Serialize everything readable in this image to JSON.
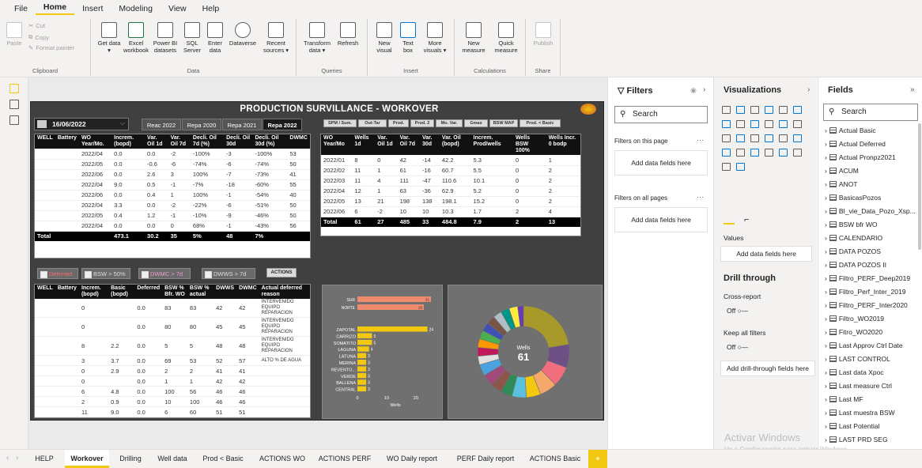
{
  "menu": {
    "items": [
      "File",
      "Home",
      "Insert",
      "Modeling",
      "View",
      "Help"
    ]
  },
  "ribbon": {
    "clipboard": {
      "paste": "Paste",
      "cut": "Cut",
      "copy": "Copy",
      "format_painter": "Format painter",
      "label": "Clipboard"
    },
    "data": {
      "get_data": "Get data ▾",
      "excel": "Excel workbook",
      "power_bi": "Power BI datasets",
      "sql": "SQL Server",
      "enter_data": "Enter data",
      "dataverse": "Dataverse",
      "recent": "Recent sources ▾",
      "label": "Data"
    },
    "queries": {
      "transform": "Transform data ▾",
      "refresh": "Refresh",
      "label": "Queries"
    },
    "insert": {
      "new_visual": "New visual",
      "text_box": "Text box",
      "more_visuals": "More visuals ▾",
      "label": "Insert"
    },
    "calculations": {
      "new_measure": "New measure",
      "quick_measure": "Quick measure",
      "label": "Calculations"
    },
    "share": {
      "publish": "Publish",
      "label": "Share"
    }
  },
  "report": {
    "title": "PRODUCTION SURVILLANCE - WORKOVER",
    "date": "16/06/2022",
    "year_buttons": [
      "Reac 2022",
      "Repa 2020",
      "Repa 2021",
      "Repa 2022"
    ],
    "small_buttons": [
      "SPM / Sum.",
      "Out-Tar",
      "Prod.",
      "Prod. 2",
      "Mo. Var.",
      "Gmax",
      "BSW MAP",
      "Prod. < Basic"
    ],
    "table1": {
      "headers": [
        "WELL",
        "Battery",
        "WO Year/Mo.",
        "Increm. (bopd)",
        "Var. Oil 1d",
        "Var. Oil 7d",
        "Decli. Oil 7d (%)",
        "Decli. Oil 30d",
        "Decli. Oil 30d (%)",
        "DWMC"
      ],
      "rows": [
        [
          "2022/04",
          "0.0",
          "0.0",
          "-2",
          "-100%",
          "-3",
          "-100%",
          "53"
        ],
        [
          "2022/05",
          "0.0",
          "-0.6",
          "-6",
          "-74%",
          "-6",
          "-74%",
          "50"
        ],
        [
          "2022/06",
          "0.0",
          "2.6",
          "3",
          "100%",
          "-7",
          "-73%",
          "41"
        ],
        [
          "2022/04",
          "9.0",
          "0.5",
          "-1",
          "-7%",
          "-18",
          "-60%",
          "55"
        ],
        [
          "2022/06",
          "0.0",
          "0.4",
          "1",
          "100%",
          "-1",
          "-54%",
          "40"
        ],
        [
          "2022/04",
          "3.3",
          "0.0",
          "-2",
          "-22%",
          "-6",
          "-51%",
          "50"
        ],
        [
          "2022/05",
          "0.4",
          "1.2",
          "-1",
          "-10%",
          "-9",
          "-46%",
          "50"
        ],
        [
          "2022/04",
          "0.0",
          "0.0",
          "0",
          "68%",
          "-1",
          "-43%",
          "56"
        ]
      ],
      "total": [
        "Total",
        "473.1",
        "30.2",
        "35",
        "5%",
        "48",
        "7%"
      ]
    },
    "table2": {
      "headers": [
        "WO Year/Mo",
        "Wells 1d",
        "Var. Oil 1d",
        "Var. Oil 7d",
        "Var. 30d",
        "Var. Oil (bopd)",
        "Increm. Prod/wells",
        "Wells BSW 100%",
        "Wells Incr. 0 bodp"
      ],
      "rows": [
        [
          "2022/01",
          "8",
          "0",
          "42",
          "-14",
          "42.2",
          "5.3",
          "0",
          "1"
        ],
        [
          "2022/02",
          "11",
          "1",
          "61",
          "-16",
          "60.7",
          "5.5",
          "0",
          "2"
        ],
        [
          "2022/03",
          "11",
          "4",
          "111",
          "-47",
          "110.6",
          "10.1",
          "0",
          "2"
        ],
        [
          "2022/04",
          "12",
          "1",
          "63",
          "-36",
          "62.9",
          "5.2",
          "0",
          "2"
        ],
        [
          "2022/05",
          "13",
          "21",
          "198",
          "138",
          "198.1",
          "15.2",
          "0",
          "2"
        ],
        [
          "2022/06",
          "6",
          "-2",
          "10",
          "10",
          "10.3",
          "1.7",
          "2",
          "4"
        ]
      ],
      "total": [
        "Total",
        "61",
        "27",
        "485",
        "33",
        "484.8",
        "7.9",
        "2",
        "13"
      ]
    },
    "checkboxes": [
      "Deferred",
      "BSW > 50%",
      "DWMC > 7d",
      "DWWS > 7d"
    ],
    "actions": "ACTIONS",
    "table3": {
      "headers": [
        "WELL",
        "Battery",
        "Increm. (bopd)",
        "Basic (bopd)",
        "Deferred",
        "BSW % Bfr. WO",
        "BSW % actual",
        "DWWS",
        "DWMC",
        "Actual deferred reason"
      ],
      "rows": [
        [
          "0",
          "",
          "0.0",
          "83",
          "83",
          "42",
          "42",
          "INTERVENIDO EQUIPO REPARACION"
        ],
        [
          "0",
          "",
          "0.0",
          "80",
          "80",
          "45",
          "45",
          "INTERVENIDO EQUIPO REPARACION"
        ],
        [
          "8",
          "2.2",
          "0.0",
          "5",
          "5",
          "48",
          "48",
          "INTERVENIDO EQUIPO REPARACION"
        ],
        [
          "3",
          "3.7",
          "0.0",
          "69",
          "53",
          "52",
          "57",
          "ALTO % DE AGUA"
        ],
        [
          "0",
          "2.9",
          "0.0",
          "2",
          "2",
          "41",
          "41",
          ""
        ],
        [
          "0",
          "",
          "0.0",
          "1",
          "1",
          "42",
          "42",
          ""
        ],
        [
          "6",
          "4.8",
          "0.0",
          "100",
          "56",
          "46",
          "46",
          ""
        ],
        [
          "2",
          "0.9",
          "0.0",
          "10",
          "100",
          "46",
          "46",
          ""
        ],
        [
          "11",
          "9.0",
          "0.0",
          "6",
          "60",
          "51",
          "51",
          ""
        ],
        [
          "12",
          "7.6",
          "0.0",
          "4",
          "59",
          "51",
          "52",
          ""
        ]
      ]
    },
    "chart_data": [
      {
        "type": "bar",
        "categories": [
          "SUR",
          "NORTE"
        ],
        "values": [
          31,
          28
        ]
      },
      {
        "type": "bar",
        "categories": [
          "ZAPOTAL",
          "CARRIZO",
          "SOMATITO",
          "LAGUNA",
          "LATUNA",
          "MERINA",
          "REVENTO...",
          "VERDE",
          "BALLENA",
          "CENTRAL"
        ],
        "values": [
          24,
          5,
          5,
          4,
          3,
          3,
          3,
          3,
          3,
          3
        ],
        "xlabel": "Wells",
        "xticks": [
          "0",
          "10",
          "20"
        ]
      },
      {
        "type": "pie",
        "center_label": "Wells",
        "center_value": "61"
      }
    ]
  },
  "filters": {
    "title": "Filters",
    "search": "Search",
    "on_page": "Filters on this page",
    "on_all": "Filters on all pages",
    "add": "Add data fields here"
  },
  "visualizations": {
    "title": "Visualizations",
    "values": "Values",
    "add_values": "Add data fields here",
    "drill": "Drill through",
    "cross_report": "Cross-report",
    "off": "Off",
    "keep_filters": "Keep all filters",
    "add_drill": "Add drill-through fields here"
  },
  "fields": {
    "title": "Fields",
    "search": "Search",
    "items": [
      "Actual Basic",
      "Actual Deferred",
      "Actual Pronpz2021",
      "ACUM",
      "ANOT",
      "BasicasPozos",
      "BI_vie_Data_Pozo_Xsp...",
      "BSW bfr WO",
      "CALENDARIO",
      "DATA POZOS",
      "DATA POZOS II",
      "Filtro_PERF_Deep2019",
      "Filtro_Perf_Inter_2019",
      "Filtro_PERF_Inter2020",
      "Filtro_WO2019",
      "Fitro_WO2020",
      "Last Approv Ctrl Date",
      "LAST CONTROL",
      "Last data Xpoc",
      "Last measure Ctrl",
      "Last MF",
      "Last muestra BSW",
      "Last Potential",
      "LAST PRD SEG"
    ]
  },
  "watermark": {
    "line1": "Activar Windows",
    "line2": "Ve a Configuración para activar Windows."
  },
  "tabs": [
    "HELP",
    "Workover",
    "Drilling",
    "Well data",
    "Prod < Basic",
    "ACTIONS WO",
    "ACTIONS PERF",
    "WO Daily report",
    "PERF Daily report",
    "ACTIONS Basic",
    "+"
  ],
  "colors": {
    "accent": "#f2c811",
    "negative": "#d13438",
    "positive": "#0078d4",
    "bar_sur": "#f08a6e",
    "bar_field": "#f2c811"
  }
}
